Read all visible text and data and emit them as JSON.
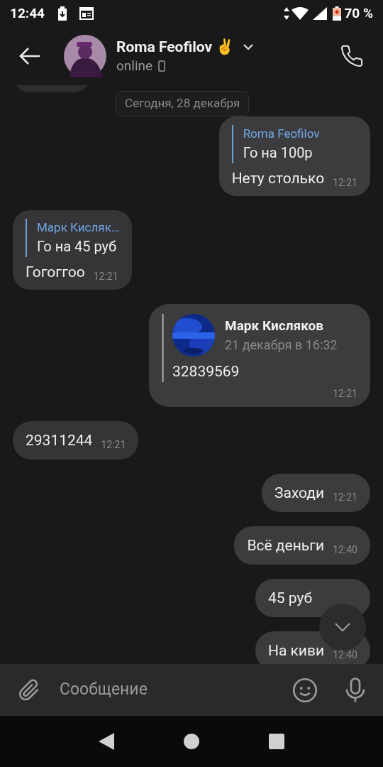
{
  "status_bar": {
    "time": "12:44",
    "battery": "70 %"
  },
  "header": {
    "name": "Roma Feofilov ✌️",
    "status": "online"
  },
  "date_chip": "Сегодня, 28 декабря",
  "messages": [
    {
      "kind": "reply",
      "out": true,
      "reply_author": "Roma Feofilov",
      "reply_text": "Го на 100р",
      "text": "Нету столько",
      "time": "12:21"
    },
    {
      "kind": "reply",
      "out": false,
      "reply_author": "Марк Кисляк…",
      "reply_text": "Го на 45 руб",
      "text": "Гогоггоо",
      "time": "12:21"
    },
    {
      "kind": "forward",
      "out": true,
      "author": "Марк Кисляков",
      "date": "21 декабря в 16:32",
      "text": "32839569",
      "time": "12:21"
    },
    {
      "kind": "text",
      "out": false,
      "text": "29311244",
      "time": "12:21"
    },
    {
      "kind": "text",
      "out": true,
      "text": "Заходи",
      "time": "12:21"
    },
    {
      "kind": "text",
      "out": true,
      "text": "Всё деньги",
      "time": "12:40"
    },
    {
      "kind": "text",
      "out": true,
      "text": "45 руб"
    },
    {
      "kind": "text",
      "out": true,
      "text": "На киви",
      "time": "12:40"
    }
  ],
  "composer": {
    "placeholder": "Сообщение"
  }
}
